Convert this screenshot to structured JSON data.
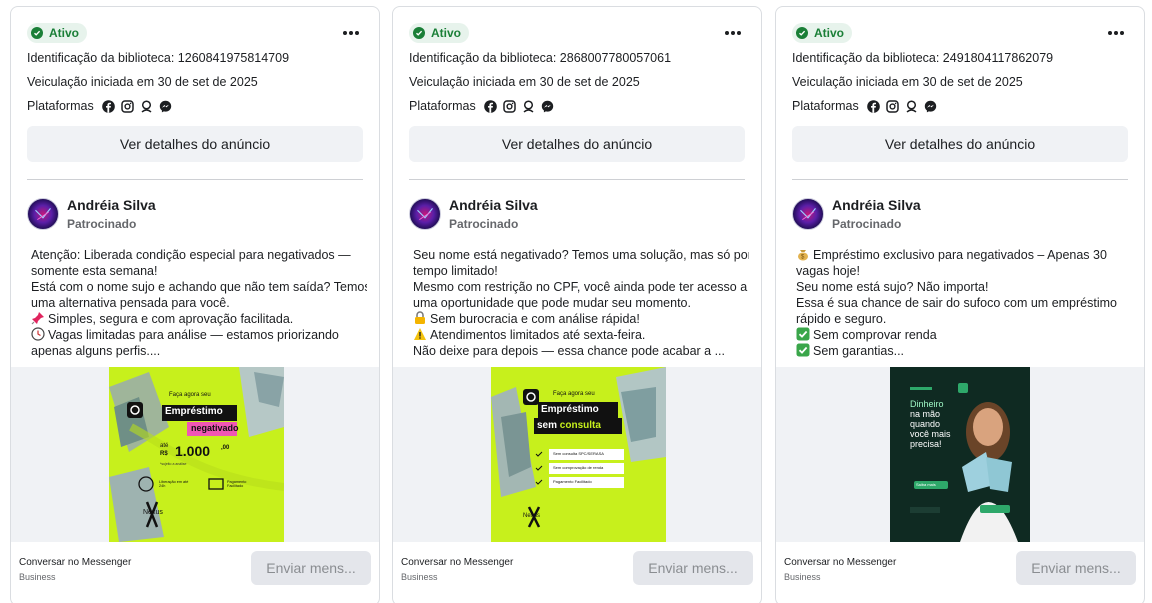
{
  "cards": [
    {
      "status": "Ativo",
      "library_id": "Identificação da biblioteca: 1260841975814709",
      "started": "Veiculação iniciada em 30 de set de 2025",
      "platforms_label": "Plataformas",
      "details_label": "Ver detalhes do anúncio",
      "advertiser": "Andréia Silva",
      "sponsored": "Patrocinado",
      "body": [
        {
          "icon": "",
          "text": "Atenção: Liberada condição especial para negativados —"
        },
        {
          "icon": "",
          "text": "somente esta semana!"
        },
        {
          "icon": "",
          "text": "Está com o nome sujo e achando que não tem saída? Temos"
        },
        {
          "icon": "",
          "text": "uma alternativa pensada para você."
        },
        {
          "icon": "pushpin-icon",
          "text": "Simples, segura e com aprovação facilitada."
        },
        {
          "icon": "clock-icon",
          "text": "Vagas limitadas para análise — estamos priorizando"
        },
        {
          "icon": "",
          "text": "apenas alguns perfis...."
        }
      ],
      "creative": {
        "kicker": "Faça agora seu",
        "headline": "Empréstimo",
        "highlight": "negativado",
        "amount_prefix": "até",
        "amount_currency": "R$",
        "amount": "1.000",
        "amount_cents": ",00",
        "small_note": "*sujeito a análise",
        "feature1": "Liberação em até 24h",
        "feature2": "Pagamento Facilitado",
        "brand": "Nexus"
      },
      "footer_title": "Conversar no Messenger",
      "footer_sub": "Business",
      "send_label": "Enviar mens..."
    },
    {
      "status": "Ativo",
      "library_id": "Identificação da biblioteca: 2868007780057061",
      "started": "Veiculação iniciada em 30 de set de 2025",
      "platforms_label": "Plataformas",
      "details_label": "Ver detalhes do anúncio",
      "advertiser": "Andréia Silva",
      "sponsored": "Patrocinado",
      "body": [
        {
          "icon": "",
          "text": "Seu nome está negativado? Temos uma solução, mas só por"
        },
        {
          "icon": "",
          "text": "tempo limitado!"
        },
        {
          "icon": "",
          "text": "Mesmo com restrição no CPF, você ainda pode ter acesso a"
        },
        {
          "icon": "",
          "text": "uma oportunidade que pode mudar seu momento."
        },
        {
          "icon": "lock-icon",
          "text": "Sem burocracia e com análise rápida!"
        },
        {
          "icon": "warning-icon",
          "text": "Atendimentos limitados até sexta-feira."
        },
        {
          "icon": "",
          "text": "Não deixe para depois — essa chance pode acabar a ..."
        }
      ],
      "creative": {
        "kicker": "Faça agora seu",
        "headline": "Empréstimo",
        "highlight_prefix": "sem",
        "highlight": "consulta",
        "check1": "Sem consulta SPC/SERASA",
        "check2": "Sem comprovação de renda",
        "check3": "Pagamento Facilitado",
        "brand": "Nexus"
      },
      "footer_title": "Conversar no Messenger",
      "footer_sub": "Business",
      "send_label": "Enviar mens..."
    },
    {
      "status": "Ativo",
      "library_id": "Identificação da biblioteca: 2491804117862079",
      "started": "Veiculação iniciada em 30 de set de 2025",
      "platforms_label": "Plataformas",
      "details_label": "Ver detalhes do anúncio",
      "advertiser": "Andréia Silva",
      "sponsored": "Patrocinado",
      "body": [
        {
          "icon": "money-bag-icon",
          "text": "Empréstimo exclusivo para negativados – Apenas 30"
        },
        {
          "icon": "",
          "text": "vagas hoje!"
        },
        {
          "icon": "",
          "text": "Seu nome está sujo? Não importa!"
        },
        {
          "icon": "",
          "text": "Essa é sua chance de sair do sufoco com um empréstimo"
        },
        {
          "icon": "",
          "text": "rápido e seguro."
        },
        {
          "icon": "check-icon",
          "text": "Sem comprovar renda"
        },
        {
          "icon": "check-icon",
          "text": "Sem garantias..."
        }
      ],
      "creative": {
        "headline_lines": [
          "Dinheiro",
          "na mão",
          "quando",
          "você mais",
          "precisa!"
        ],
        "cta": "Saiba mais"
      },
      "footer_title": "Conversar no Messenger",
      "footer_sub": "Business",
      "send_label": "Enviar mens..."
    }
  ],
  "colors": {
    "active_green": "#1a7f37",
    "creative_lime": "#c7f01c",
    "creative_dark": "#0f2a22"
  }
}
